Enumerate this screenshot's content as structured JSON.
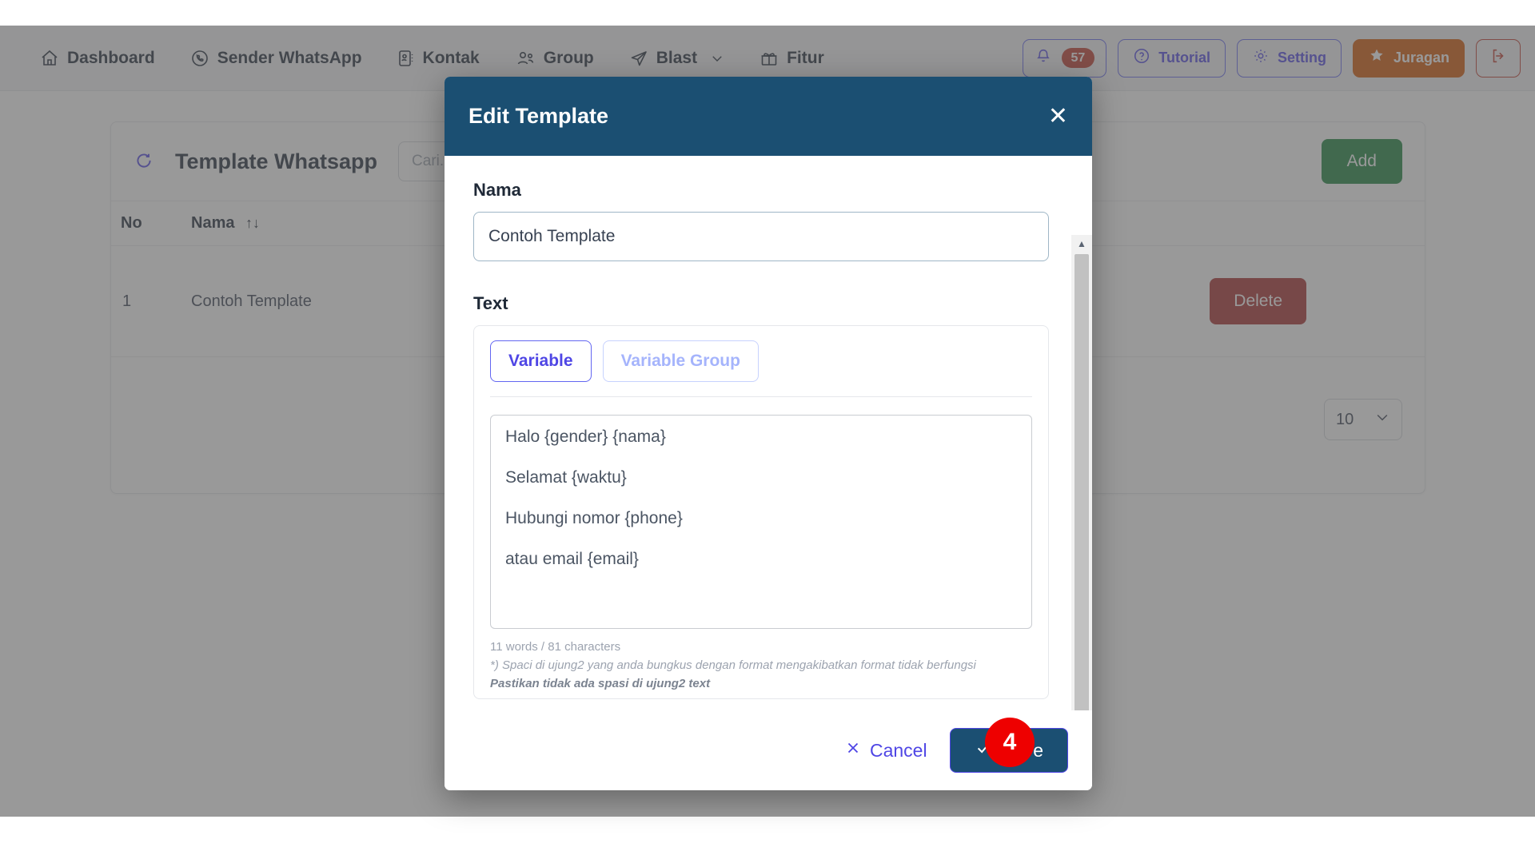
{
  "navbar": {
    "items": [
      {
        "label": "Dashboard",
        "icon": "home-icon"
      },
      {
        "label": "Sender WhatsApp",
        "icon": "whatsapp-icon"
      },
      {
        "label": "Kontak",
        "icon": "contact-card-icon"
      },
      {
        "label": "Group",
        "icon": "users-icon"
      },
      {
        "label": "Blast",
        "icon": "paper-plane-icon",
        "caret": true
      },
      {
        "label": "Fitur",
        "icon": "gift-icon"
      }
    ],
    "notifications": {
      "icon": "bell-icon",
      "count": "57"
    },
    "tutorial": {
      "label": "Tutorial",
      "icon": "question-circle-icon"
    },
    "setting": {
      "label": "Setting",
      "icon": "gear-icon"
    },
    "juragan": {
      "label": "Juragan",
      "icon": "star-icon"
    },
    "logout": {
      "icon": "logout-icon"
    }
  },
  "page": {
    "refresh_icon": "refresh-icon",
    "title": "Template Whatsapp",
    "search_placeholder": "Cari...",
    "add_label": "Add",
    "table": {
      "headers": [
        "No",
        "Nama"
      ],
      "sort_icon": "sort-updown-icon",
      "rows": [
        {
          "no": "1",
          "nama": "Contoh Template",
          "delete_label": "Delete"
        }
      ]
    },
    "per_page": {
      "value": "10",
      "caret_icon": "chevron-down-icon"
    }
  },
  "modal": {
    "title": "Edit Template",
    "close_icon": "close-icon",
    "nama_label": "Nama",
    "nama_value": "Contoh Template",
    "text_label": "Text",
    "tabs": [
      {
        "label": "Variable",
        "active": true
      },
      {
        "label": "Variable Group",
        "active": false
      }
    ],
    "message_lines": [
      "Halo {gender} {nama}",
      "Selamat {waktu}",
      "Hubungi nomor {phone}",
      "atau email {email}"
    ],
    "counter": "11 words / 81 characters",
    "note_1": "*) Spaci di ujung2 yang anda bungkus dengan format mengakibatkan format tidak berfungsi",
    "note_2": "Pastikan tidak ada spasi di ujung2 text",
    "cancel_label": "Cancel",
    "cancel_icon": "x-icon",
    "save_label": "Save",
    "save_icon": "check-icon",
    "scroll_up_icon": "triangle-up-icon",
    "scroll_down_icon": "triangle-down-icon"
  },
  "annotation": {
    "step": "4"
  }
}
